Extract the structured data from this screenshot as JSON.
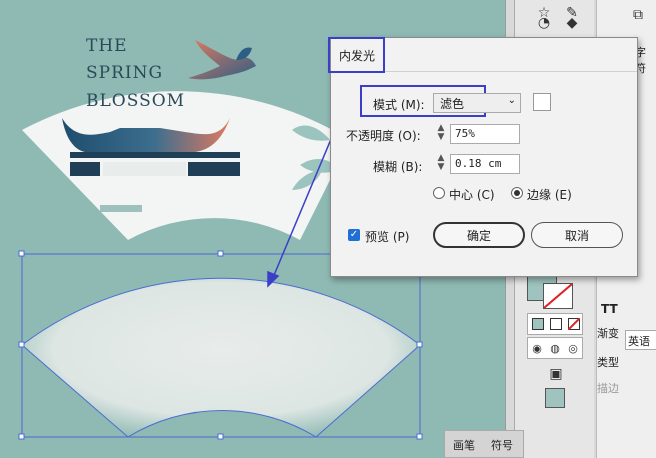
{
  "poster": {
    "line1": "THE",
    "line2": "SPRING",
    "line3": "BLOSSOM"
  },
  "dialog": {
    "title": "内发光",
    "mode_label": "模式 (M):",
    "mode_value": "滤色",
    "opacity_label": "不透明度 (O):",
    "opacity_value": "75%",
    "blur_label": "模糊 (B):",
    "blur_value": "0.18 cm",
    "center_label": "中心 (C)",
    "edge_label": "边缘 (E)",
    "edge_selected": true,
    "preview_label": "预览 (P)",
    "preview_checked": true,
    "ok_label": "确定",
    "cancel_label": "取消"
  },
  "panel": {
    "char_tab": "字符",
    "gradient_label": "渐变",
    "type_label": "类型",
    "stroke_label": "描边",
    "lang_value": "英语",
    "tt_label": "TT"
  },
  "bottom_tabs": {
    "brush": "画笔",
    "symbol": "符号"
  },
  "colors": {
    "canvas_bg": "#8fb9b3",
    "highlight": "#3a3ec8",
    "selection": "#4a6cd4",
    "checkbox_blue": "#1f6fd6"
  }
}
